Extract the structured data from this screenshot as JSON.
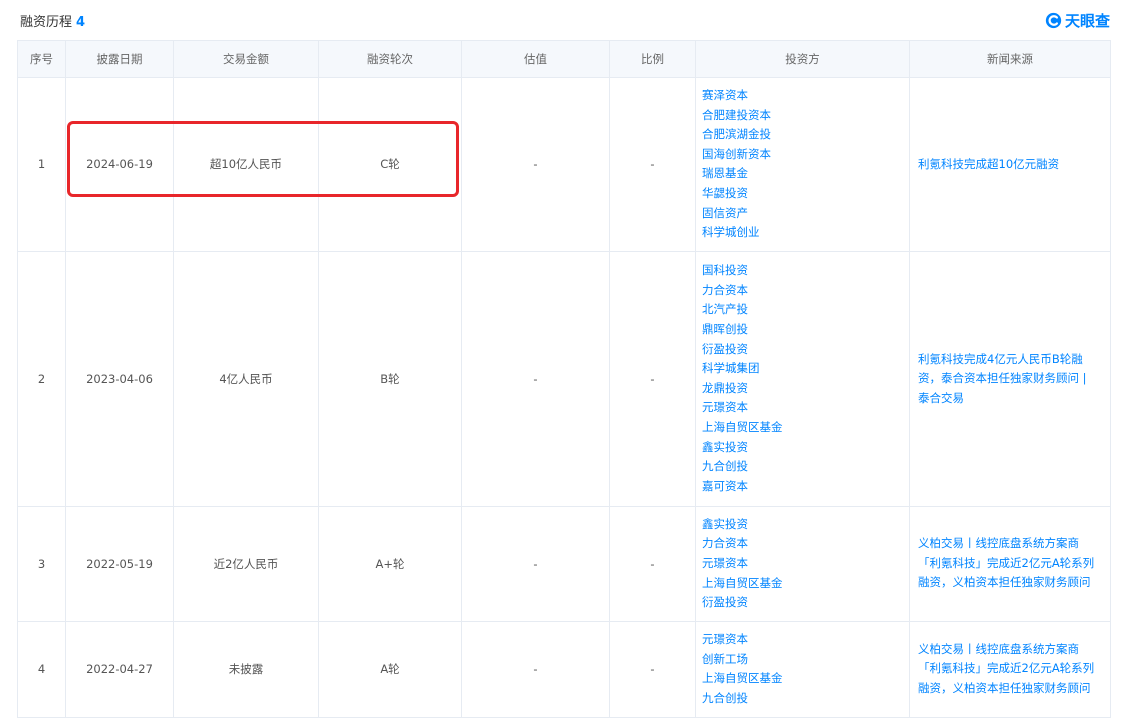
{
  "section": {
    "title": "融资历程",
    "count": "4"
  },
  "logo": {
    "text": "天眼查"
  },
  "colors": {
    "accent": "#0084ff",
    "highlight": "#e8262a",
    "header_bg": "#f5f8fc"
  },
  "table": {
    "headers": [
      "序号",
      "披露日期",
      "交易金额",
      "融资轮次",
      "估值",
      "比例",
      "投资方",
      "新闻来源"
    ],
    "rows": [
      {
        "index": "1",
        "date": "2024-06-19",
        "amount": "超10亿人民币",
        "round": "C轮",
        "valuation": "-",
        "ratio": "-",
        "investors": [
          "赛泽资本",
          "合肥建投资本",
          "合肥滨湖金投",
          "国海创新资本",
          "瑞恩基金",
          "华勰投资",
          "固信资产",
          "科学城创业"
        ],
        "news": "利氪科技完成超10亿元融资"
      },
      {
        "index": "2",
        "date": "2023-04-06",
        "amount": "4亿人民币",
        "round": "B轮",
        "valuation": "-",
        "ratio": "-",
        "investors": [
          "国科投资",
          "力合资本",
          "北汽产投",
          "鼎晖创投",
          "衍盈投资",
          "科学城集团",
          "龙鼎投资",
          "元璟资本",
          "上海自贸区基金",
          "鑫实投资",
          "九合创投",
          "嘉可资本"
        ],
        "news": "利氪科技完成4亿元人民币B轮融资，泰合资本担任独家财务顾问 | 泰合交易"
      },
      {
        "index": "3",
        "date": "2022-05-19",
        "amount": "近2亿人民币",
        "round": "A+轮",
        "valuation": "-",
        "ratio": "-",
        "investors": [
          "鑫实投资",
          "力合资本",
          "元璟资本",
          "上海自贸区基金",
          "衍盈投资"
        ],
        "news": "义柏交易丨线控底盘系统方案商「利氪科技」完成近2亿元A轮系列融资，义柏资本担任独家财务顾问"
      },
      {
        "index": "4",
        "date": "2022-04-27",
        "amount": "未披露",
        "round": "A轮",
        "valuation": "-",
        "ratio": "-",
        "investors": [
          "元璟资本",
          "创新工场",
          "上海自贸区基金",
          "九合创投"
        ],
        "news": "义柏交易丨线控底盘系统方案商「利氪科技」完成近2亿元A轮系列融资，义柏资本担任独家财务顾问"
      }
    ]
  }
}
